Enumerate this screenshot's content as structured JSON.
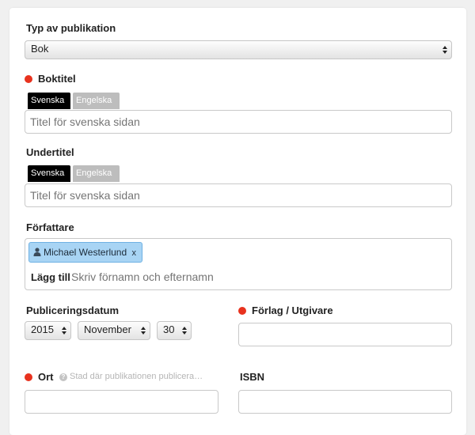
{
  "publication_type": {
    "label": "Typ av publikation",
    "selected": "Bok"
  },
  "book_title": {
    "label": "Boktitel",
    "tabs": [
      "Svenska",
      "Engelska"
    ],
    "placeholder": "Titel för svenska sidan"
  },
  "subtitle": {
    "label": "Undertitel",
    "tabs": [
      "Svenska",
      "Engelska"
    ],
    "placeholder": "Titel för svenska sidan"
  },
  "authors": {
    "label": "Författare",
    "chips": [
      "Michael Westerlund"
    ],
    "chip_remove": "x",
    "add_label": "Lägg till",
    "add_placeholder": "Skriv förnamn och efternamn"
  },
  "publication_date": {
    "label": "Publiceringsdatum",
    "year": "2015",
    "month": "November",
    "day": "30"
  },
  "publisher": {
    "label": "Förlag / Utgivare",
    "value": ""
  },
  "place": {
    "label": "Ort",
    "helper": "Stad där publikationen publicera…",
    "value": ""
  },
  "isbn": {
    "label": "ISBN",
    "value": ""
  },
  "colors": {
    "required_dot": "#e8321e",
    "chip_bg": "#a8d4f4",
    "tab_active": "#000000",
    "tab_inactive": "#bdbdbd"
  }
}
